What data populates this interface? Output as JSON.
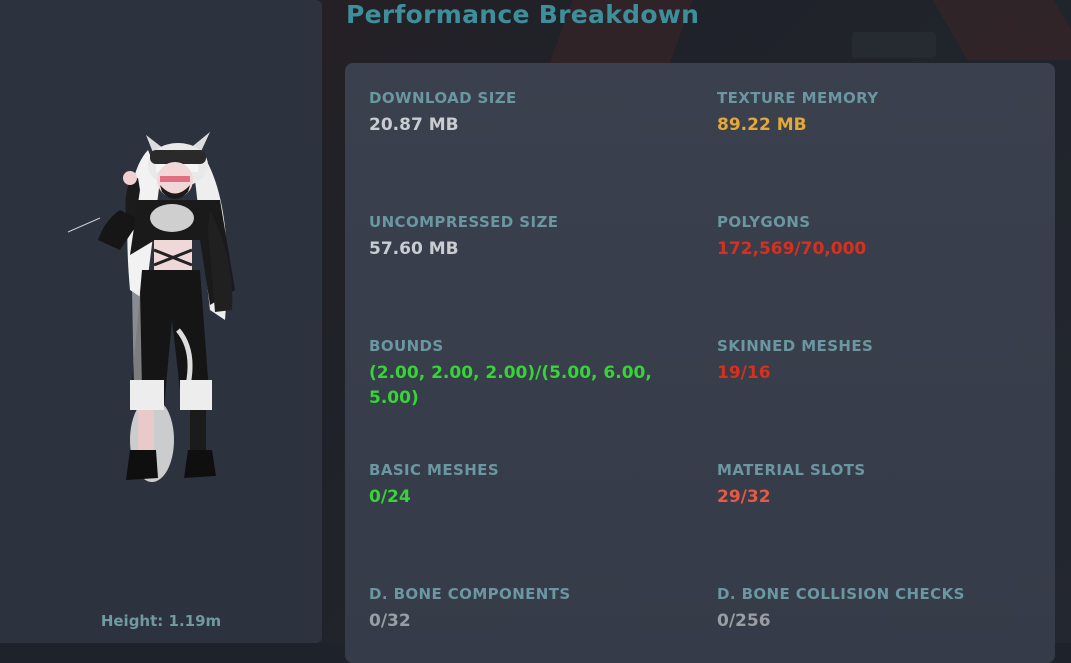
{
  "title": "Performance Breakdown",
  "avatar": {
    "height_label": "Height: 1.19m"
  },
  "stats": [
    {
      "label": "DOWNLOAD SIZE",
      "value": "20.87 MB",
      "color": "#c9ccd1"
    },
    {
      "label": "TEXTURE MEMORY",
      "value": "89.22 MB",
      "color": "#e3a83a"
    },
    {
      "label": "UNCOMPRESSED SIZE",
      "value": "57.60 MB",
      "color": "#c9ccd1"
    },
    {
      "label": "POLYGONS",
      "value": "172,569/70,000",
      "color": "#d8301f"
    },
    {
      "label": "BOUNDS",
      "value": "(2.00, 2.00, 2.00)/(5.00, 6.00, 5.00)",
      "color": "#37d437"
    },
    {
      "label": "SKINNED MESHES",
      "value": "19/16",
      "color": "#d8301f"
    },
    {
      "label": "BASIC MESHES",
      "value": "0/24",
      "color": "#37d437"
    },
    {
      "label": "MATERIAL SLOTS",
      "value": "29/32",
      "color": "#e55a45"
    },
    {
      "label": "D. BONE COMPONENTS",
      "value": "0/32",
      "color": "#9a9da3"
    },
    {
      "label": "D. BONE COLLISION CHECKS",
      "value": "0/256",
      "color": "#9a9da3"
    }
  ]
}
